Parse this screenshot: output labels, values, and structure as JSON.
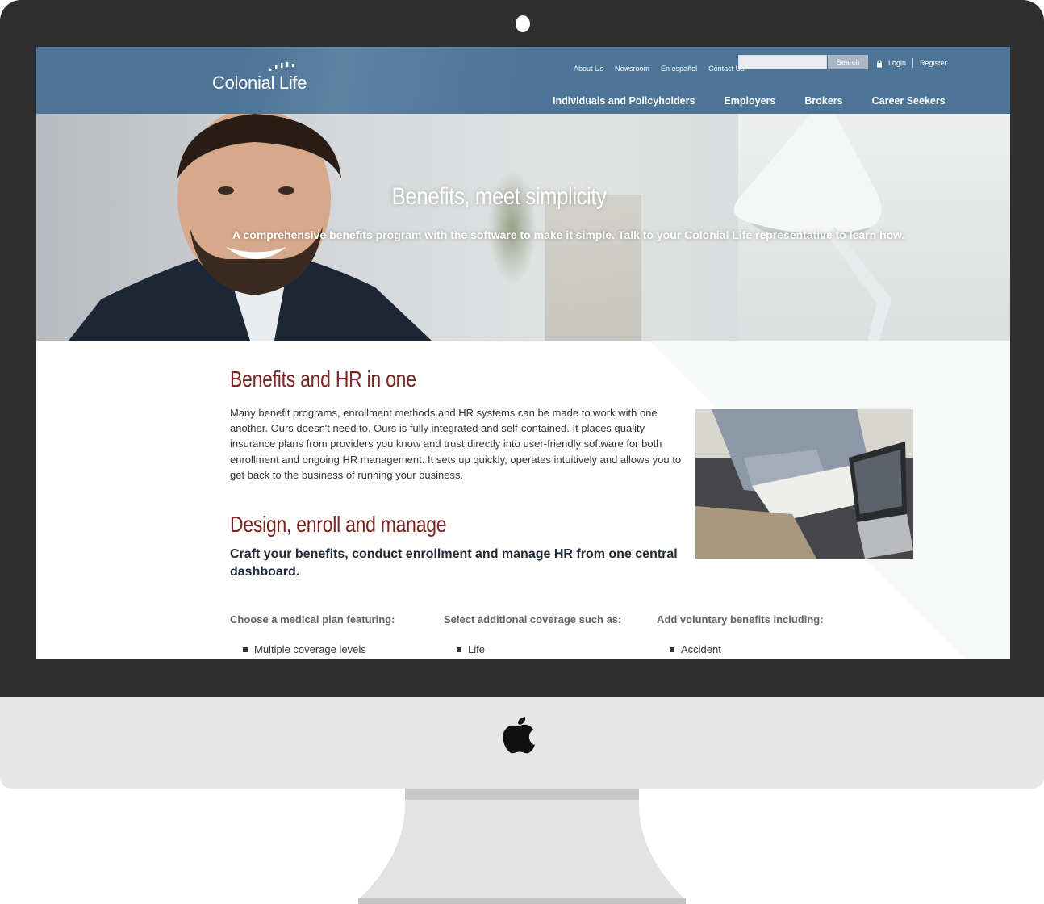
{
  "header": {
    "logo_text": "Colonial Life",
    "util_links": [
      "About Us",
      "Newsroom",
      "En español",
      "Contact Us"
    ],
    "search": {
      "placeholder": "",
      "button_label": "Search"
    },
    "login_label": "Login",
    "register_label": "Register",
    "main_nav": [
      "Individuals and Policyholders",
      "Employers",
      "Brokers",
      "Career Seekers"
    ]
  },
  "hero": {
    "title": "Benefits, meet simplicity",
    "subtitle": "A comprehensive benefits program with the software to make it simple. Talk to your Colonial Life representative to learn how."
  },
  "content": {
    "heading_1": "Benefits and HR in one",
    "intro": "Many benefit programs, enrollment methods and HR systems can be made to work with one another. Ours doesn't need to. Ours is fully integrated and self-contained. It places quality insurance plans from providers you know and trust directly into user-friendly software for both enrollment and ongoing HR management. It sets up quickly, operates intuitively and allows you to get back to the business of running your business.",
    "heading_2": "Design, enroll and manage",
    "lead": "Craft your benefits, conduct enrollment and manage HR from one central dashboard.",
    "columns": [
      {
        "heading": "Choose a medical plan featuring:",
        "items": [
          "Multiple coverage levels"
        ]
      },
      {
        "heading": "Select additional coverage such as:",
        "items": [
          "Life"
        ]
      },
      {
        "heading": "Add voluntary benefits including:",
        "items": [
          "Accident"
        ]
      }
    ]
  },
  "colors": {
    "header_blue": "#4c7496",
    "heading_red": "#7b2421",
    "bezel": "#2f2f2f",
    "chin": "#e6e6e6"
  }
}
